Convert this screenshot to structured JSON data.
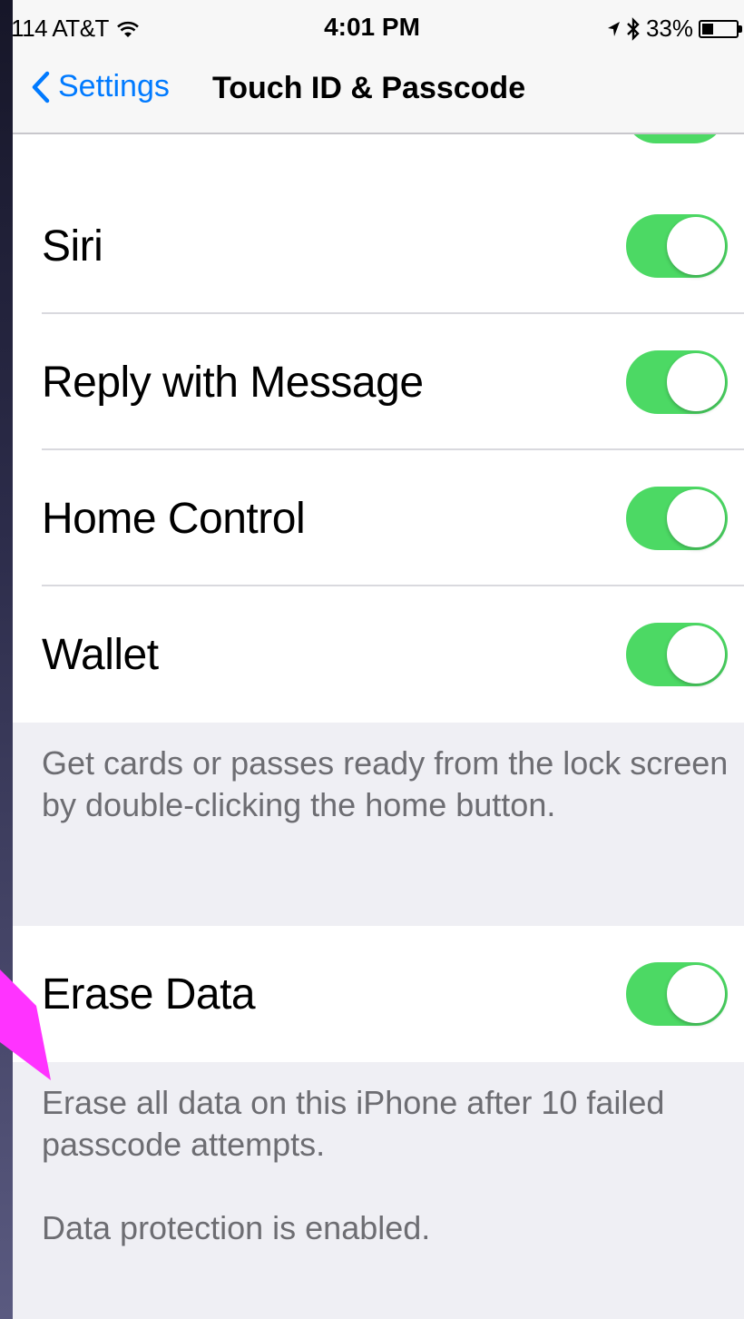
{
  "status_bar": {
    "carrier": "-114 AT&T",
    "wifi_icon": "wifi-icon",
    "time": "4:01 PM",
    "location_icon": "location-arrow-icon",
    "bluetooth_icon": "bluetooth-icon",
    "battery_percent": "33%",
    "battery_level": 0.33
  },
  "nav": {
    "back_label": "Settings",
    "title": "Touch ID & Passcode"
  },
  "allow_access_rows": [
    {
      "label": "Siri",
      "on": true
    },
    {
      "label": "Reply with Message",
      "on": true
    },
    {
      "label": "Home Control",
      "on": true
    },
    {
      "label": "Wallet",
      "on": true
    }
  ],
  "wallet_footer": "Get cards or passes ready from the lock screen by double-clicking the home button.",
  "erase": {
    "label": "Erase Data",
    "on": true,
    "footer_1": "Erase all data on this iPhone after 10 failed passcode attempts.",
    "footer_2": "Data protection is enabled."
  },
  "colors": {
    "accent": "#007aff",
    "toggle_on": "#4cd964",
    "grouped_bg": "#efeff4",
    "footer_text": "#6d6d72",
    "annotation_arrow": "#ff33ff"
  }
}
